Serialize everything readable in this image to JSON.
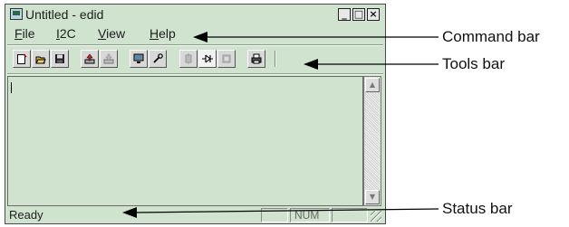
{
  "window": {
    "title": "Untitled - edid",
    "controls": {
      "minimize": "_",
      "maximize": "□",
      "close": "×"
    }
  },
  "menu": [
    {
      "prefix": "",
      "underline": "F",
      "rest": "ile",
      "name": "menu-file"
    },
    {
      "prefix": "",
      "underline": "I",
      "rest": "2C",
      "name": "menu-i2c"
    },
    {
      "prefix": "",
      "underline": "V",
      "rest": "iew",
      "name": "menu-view"
    },
    {
      "prefix": "",
      "underline": "H",
      "rest": "elp",
      "name": "menu-help"
    }
  ],
  "toolbar": {
    "icons": [
      "new-icon",
      "open-icon",
      "save-icon",
      "upload-icon",
      "download-icon",
      "monitor-icon",
      "tool-icon",
      "disabled-icon",
      "connect-icon",
      "chip-icon",
      "print-icon"
    ]
  },
  "status": {
    "text": "Ready",
    "num": "NUM"
  },
  "callouts": {
    "command_bar": "Command bar",
    "tools_bar": "Tools bar",
    "status_bar": "Status bar"
  },
  "colors": {
    "window_bg": "#cfe3cf",
    "arrow": "#000000"
  }
}
